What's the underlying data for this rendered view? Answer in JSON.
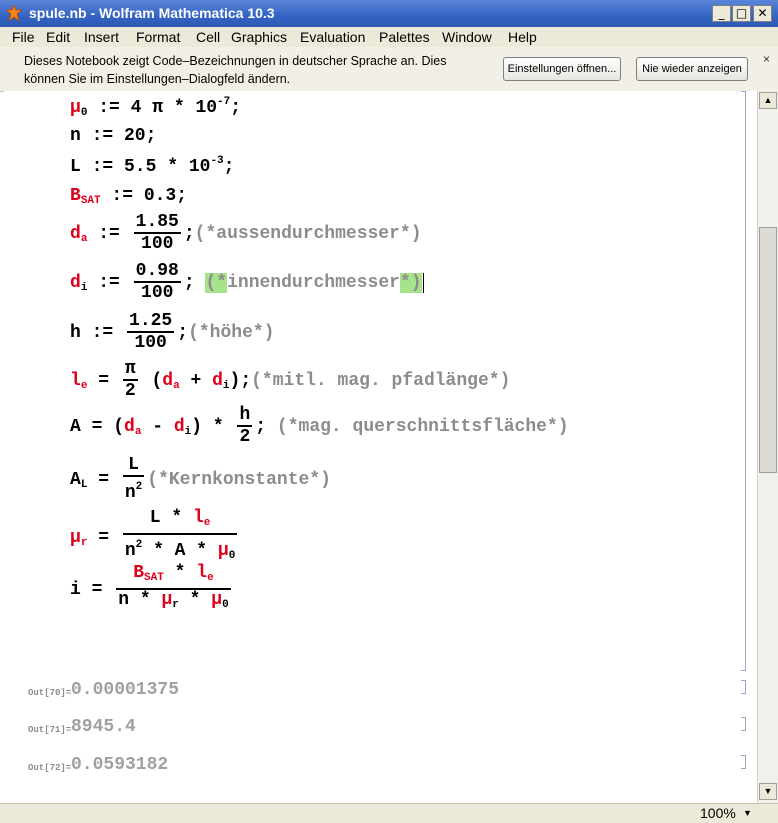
{
  "window": {
    "title": "spule.nb - Wolfram Mathematica 10.3",
    "icons": {
      "app": "mathematica-star-icon",
      "minimize": "minimize-icon",
      "maximize": "maximize-icon",
      "close": "close-icon"
    }
  },
  "menu": [
    "File",
    "Edit",
    "Insert",
    "Format",
    "Cell",
    "Graphics",
    "Evaluation",
    "Palettes",
    "Window",
    "Help"
  ],
  "notice": {
    "line1": "Dieses Notebook zeigt Code–Bezeichnungen in deutscher Sprache an. Dies",
    "line2": "können Sie im Einstellungen–Dialogfeld ändern.",
    "btn_settings": "Einstellungen öffnen...",
    "btn_never": "Nie wieder anzeigen",
    "close": "×"
  },
  "code": {
    "mu0": {
      "sym": "μ",
      "sub": "0",
      "rhs1": " := 4 π * 10",
      "exp": "-7",
      "rhs2": ";"
    },
    "n": {
      "text": "n := 20;"
    },
    "L": {
      "lhs": "L := 5.5 * 10",
      "exp": "-3",
      "end": ";"
    },
    "bsat": {
      "sym": "B",
      "sub": "SAT",
      "rhs": " := 0.3;"
    },
    "da": {
      "sym": "d",
      "sub": "a",
      "op": " :=",
      "num": "1.85",
      "den": "100",
      "semi": ";",
      "comment": "(*aussendurchmesser*)"
    },
    "di": {
      "sym": "d",
      "sub": "i",
      "op": " :=",
      "num": "0.98",
      "den": "100",
      "semi": ";",
      "c_open": "(*",
      "c_text": "innendurchmesser",
      "c_close": "*)"
    },
    "h": {
      "lhs": "h :=",
      "num": "1.25",
      "den": "100",
      "semi": ";",
      "comment": "(*höhe*)"
    },
    "le": {
      "sym": "l",
      "sub": "e",
      "op": " =",
      "num": "π",
      "den": "2",
      "p_open": " (",
      "da_sym": "d",
      "da_sub": "a",
      "plus": " + ",
      "di_sym": "d",
      "di_sub": "i",
      "p_close": ");",
      "comment": "(*mitl. mag. pfadlänge*)"
    },
    "A": {
      "lhs": "A = (",
      "da_sym": "d",
      "da_sub": "a",
      "minus": " - ",
      "di_sym": "d",
      "di_sub": "i",
      "mid": ") *",
      "num": "h",
      "den": "2",
      "semi": ";",
      "comment": " (*mag. querschnittsfläche*)"
    },
    "AL": {
      "sym": "A",
      "sub": "L",
      "op": " =",
      "num": "L",
      "den_base": "n",
      "den_exp": "2",
      "comment": "(*Kernkonstante*)"
    },
    "mur": {
      "sym": "μ",
      "sub": "r",
      "op": " =",
      "num_a": "L * ",
      "num_sym": "l",
      "num_sub": "e",
      "den_a": "n",
      "den_exp": "2",
      "den_b": " * A * ",
      "den_sym": "μ",
      "den_sub": "0"
    },
    "i": {
      "lhs": "i =",
      "num_sym1": "B",
      "num_sub1": "SAT",
      "num_mid": " * ",
      "num_sym2": "l",
      "num_sub2": "e",
      "den_a": "n * ",
      "den_sym1": "μ",
      "den_sub1": "r",
      "den_mid": " * ",
      "den_sym2": "μ",
      "den_sub2": "0"
    }
  },
  "outputs": [
    {
      "label": "Out[70]=",
      "value": "0.00001375"
    },
    {
      "label": "Out[71]=",
      "value": "8945.4"
    },
    {
      "label": "Out[72]=",
      "value": "0.0593182"
    }
  ],
  "status": {
    "zoom": "100%"
  },
  "colors": {
    "symbol": "#e0001a",
    "comment": "#8c8c8c",
    "highlight": "#a6e38c",
    "titlebar": "#3464c4"
  }
}
